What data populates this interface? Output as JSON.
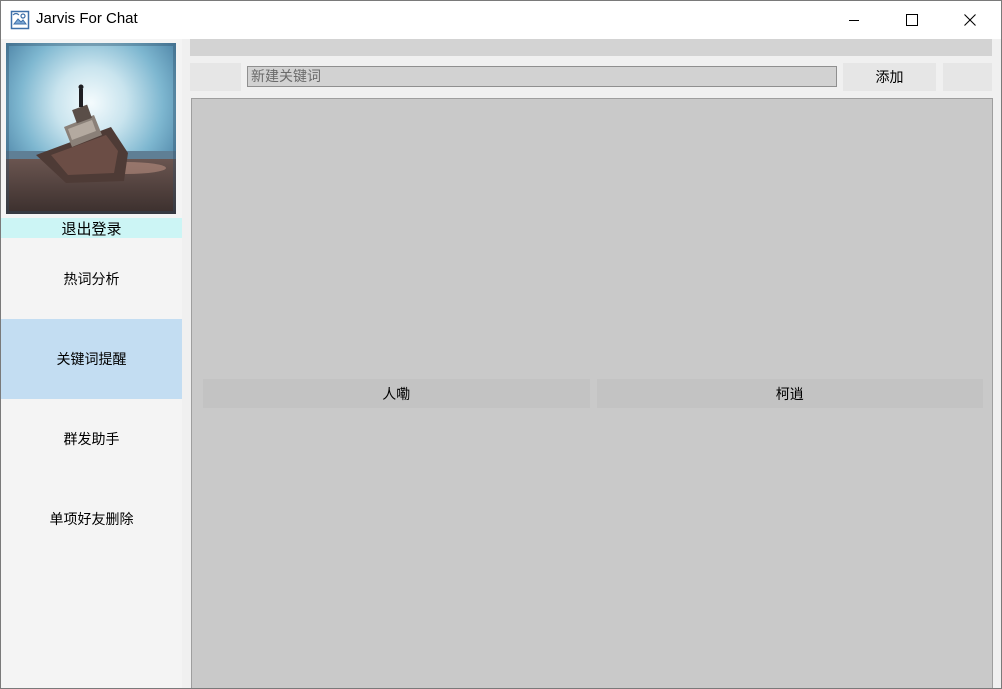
{
  "window": {
    "title": "Jarvis For Chat"
  },
  "sidebar": {
    "logout_label": "退出登录",
    "items": [
      {
        "label": "热词分析",
        "active": false
      },
      {
        "label": "关键词提醒",
        "active": true
      },
      {
        "label": "群发助手",
        "active": false
      },
      {
        "label": "单项好友删除",
        "active": false
      }
    ]
  },
  "toolbar": {
    "keyword_placeholder": "新建关键词",
    "keyword_value": "",
    "add_label": "添加"
  },
  "keywords": [
    "人嘞",
    "柯逍"
  ],
  "colors": {
    "active_nav": "#c3ddf2",
    "logout_bg": "#ccf5f5",
    "panel_bg": "#c9c9c9"
  }
}
